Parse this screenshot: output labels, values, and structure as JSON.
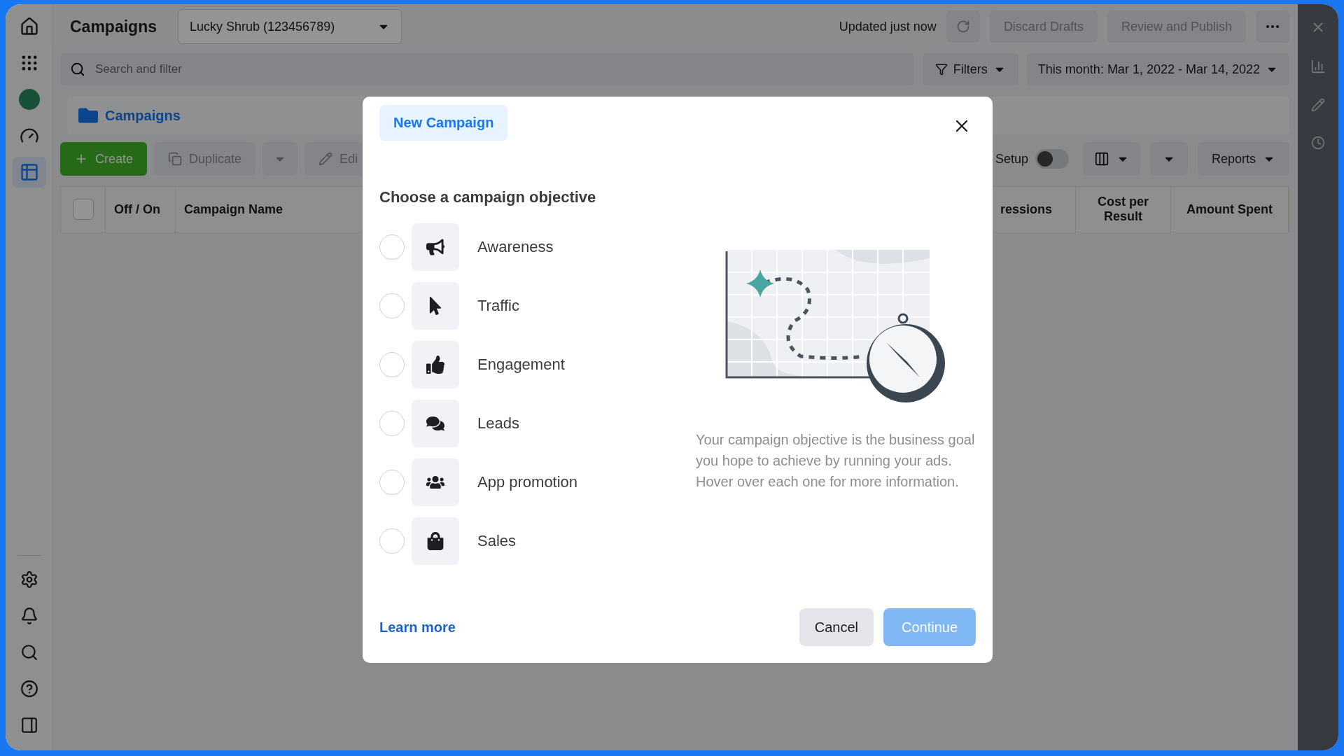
{
  "sidebar": {
    "items": [
      {
        "kind": "home",
        "selected": false
      },
      {
        "kind": "apps",
        "selected": false
      },
      {
        "kind": "avatar",
        "selected": false
      },
      {
        "kind": "gauge",
        "selected": false
      },
      {
        "kind": "table",
        "selected": true
      }
    ],
    "bottom_items": [
      {
        "kind": "settings"
      },
      {
        "kind": "bell"
      },
      {
        "kind": "search"
      },
      {
        "kind": "help"
      },
      {
        "kind": "panel"
      }
    ]
  },
  "header": {
    "title": "Campaigns",
    "account": "Lucky Shrub (123456789)",
    "status": "Updated just now",
    "buttons": [
      {
        "label": "Discard Drafts",
        "disabled": true
      },
      {
        "label": "Review and Publish",
        "disabled": true
      }
    ]
  },
  "search": {
    "placeholder": "Search and filter"
  },
  "filters": "Filters",
  "date_range": "This month: Mar 1, 2022 - Mar 14, 2022",
  "section_tab": "Campaigns",
  "toolbar": {
    "create": "Create",
    "duplicate": "Duplicate",
    "edit": "Edi",
    "view_setup": "Setup",
    "view_setup_on": false,
    "reports": "Reports"
  },
  "table": {
    "select_all_checked": false,
    "columns": [
      "Off / On",
      "Campaign Name",
      "ressions",
      "Cost per Result",
      "Amount Spent"
    ]
  },
  "dialog": {
    "tab": "New Campaign",
    "heading": "Choose a campaign objective",
    "objectives": [
      {
        "kind": "awareness",
        "label": "Awareness",
        "selected": false
      },
      {
        "kind": "traffic",
        "label": "Traffic",
        "selected": false
      },
      {
        "kind": "engagement",
        "label": "Engagement",
        "selected": false
      },
      {
        "kind": "leads",
        "label": "Leads",
        "selected": false
      },
      {
        "kind": "app",
        "label": "App promotion",
        "selected": false
      },
      {
        "kind": "sales",
        "label": "Sales",
        "selected": false
      }
    ],
    "description": "Your campaign objective is the business goal you hope to achieve by running your ads. Hover over each one for more information.",
    "learn_more": "Learn more",
    "buttons": [
      {
        "label": "Cancel",
        "disabled": false
      },
      {
        "label": "Continue",
        "disabled": true
      }
    ]
  }
}
